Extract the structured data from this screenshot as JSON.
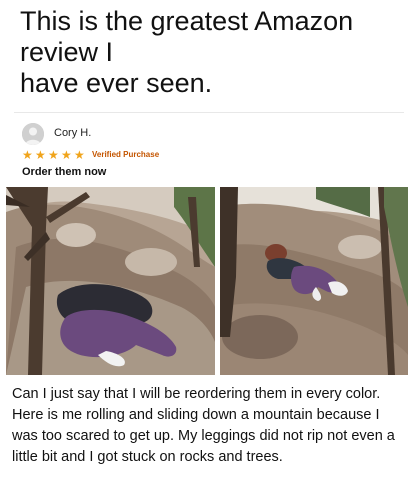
{
  "headline": {
    "line1": "This is the greatest Amazon",
    "line2": "review I",
    "line3": "have ever seen."
  },
  "review": {
    "reviewer_name": "Cory H.",
    "rating": 5,
    "verified_label": "Verified Purchase",
    "title": "Order them now",
    "body": "Can I just say that I will be reordering them in every color. Here is me rolling and sliding down a mountain because I was too scared to get up. My leggings did not rip not even a little bit and I got stuck on rocks and trees."
  },
  "colors": {
    "star": "#f0a41b",
    "verified": "#c45500",
    "leggings": "#6b4a7e",
    "rock": "#8a7563"
  },
  "icons": {
    "avatar": "user-avatar-icon",
    "star": "star-icon"
  }
}
